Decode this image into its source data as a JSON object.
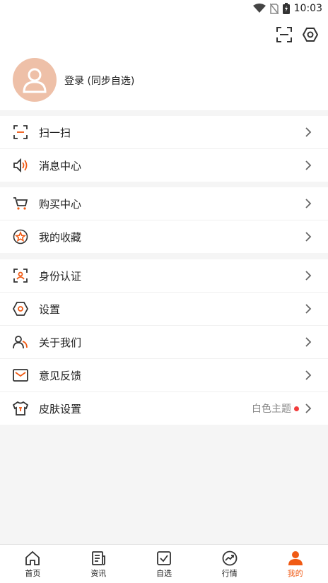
{
  "status": {
    "time": "10:03"
  },
  "header": {
    "login_text": "登录 (同步自选)"
  },
  "groups": [
    [
      {
        "label": "扫一扫",
        "icon": "scan-icon"
      },
      {
        "label": "消息中心",
        "icon": "speaker-icon"
      }
    ],
    [
      {
        "label": "购买中心",
        "icon": "cart-icon"
      },
      {
        "label": "我的收藏",
        "icon": "star-icon"
      }
    ],
    [
      {
        "label": "身份认证",
        "icon": "id-verify-icon"
      },
      {
        "label": "设置",
        "icon": "settings-icon"
      },
      {
        "label": "关于我们",
        "icon": "about-icon"
      },
      {
        "label": "意见反馈",
        "icon": "mail-icon"
      },
      {
        "label": "皮肤设置",
        "icon": "shirt-icon",
        "extra": "白色主题"
      }
    ]
  ],
  "tabs": [
    {
      "label": "首页",
      "icon": "home-icon"
    },
    {
      "label": "资讯",
      "icon": "news-icon"
    },
    {
      "label": "自选",
      "icon": "checkbox-icon"
    },
    {
      "label": "行情",
      "icon": "trend-icon"
    },
    {
      "label": "我的",
      "icon": "profile-icon",
      "active": true
    }
  ],
  "colors": {
    "accent": "#f05a14",
    "avatar_bg": "#eec0a8",
    "dot": "#f23c3c"
  }
}
